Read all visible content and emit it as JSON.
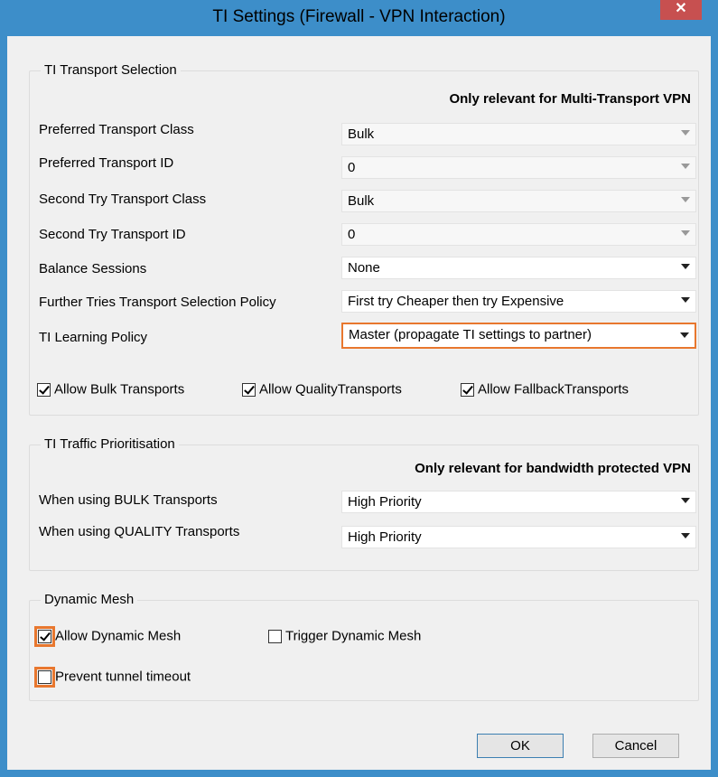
{
  "window": {
    "title": "TI Settings (Firewall - VPN Interaction)",
    "close_glyph": "✕"
  },
  "transport": {
    "legend": "TI Transport Selection",
    "note": "Only relevant for Multi-Transport VPN",
    "rows": [
      {
        "label": "Preferred Transport Class",
        "value": "Bulk"
      },
      {
        "label": "Preferred Transport ID",
        "value": "0"
      },
      {
        "label": "Second Try Transport Class",
        "value": "Bulk"
      },
      {
        "label": "Second Try Transport ID",
        "value": "0"
      },
      {
        "label": "Balance Sessions",
        "value": "None"
      },
      {
        "label": "Further Tries Transport Selection Policy",
        "value": "First try Cheaper then try Expensive"
      },
      {
        "label": "TI Learning Policy",
        "value": "Master (propagate TI settings to partner)"
      }
    ],
    "checkboxes": [
      {
        "label": "Allow Bulk Transports",
        "checked": true
      },
      {
        "label": "Allow QualityTransports",
        "checked": true
      },
      {
        "label": "Allow FallbackTransports",
        "checked": true
      }
    ]
  },
  "traffic": {
    "legend": "TI Traffic Prioritisation",
    "note": "Only relevant for bandwidth protected VPN",
    "rows": [
      {
        "label": "When using BULK Transports",
        "value": "High Priority"
      },
      {
        "label": "When using QUALITY Transports",
        "value": "High Priority"
      }
    ]
  },
  "mesh": {
    "legend": "Dynamic Mesh",
    "allow": {
      "label": "Allow Dynamic Mesh",
      "checked": true
    },
    "trigger": {
      "label": "Trigger Dynamic Mesh",
      "checked": false
    },
    "prevent": {
      "label": "Prevent tunnel timeout",
      "checked": false
    }
  },
  "buttons": {
    "ok": "OK",
    "cancel": "Cancel"
  },
  "colors": {
    "titlebar": "#3d8ec9",
    "highlight": "#e8772e",
    "close": "#c75050"
  }
}
